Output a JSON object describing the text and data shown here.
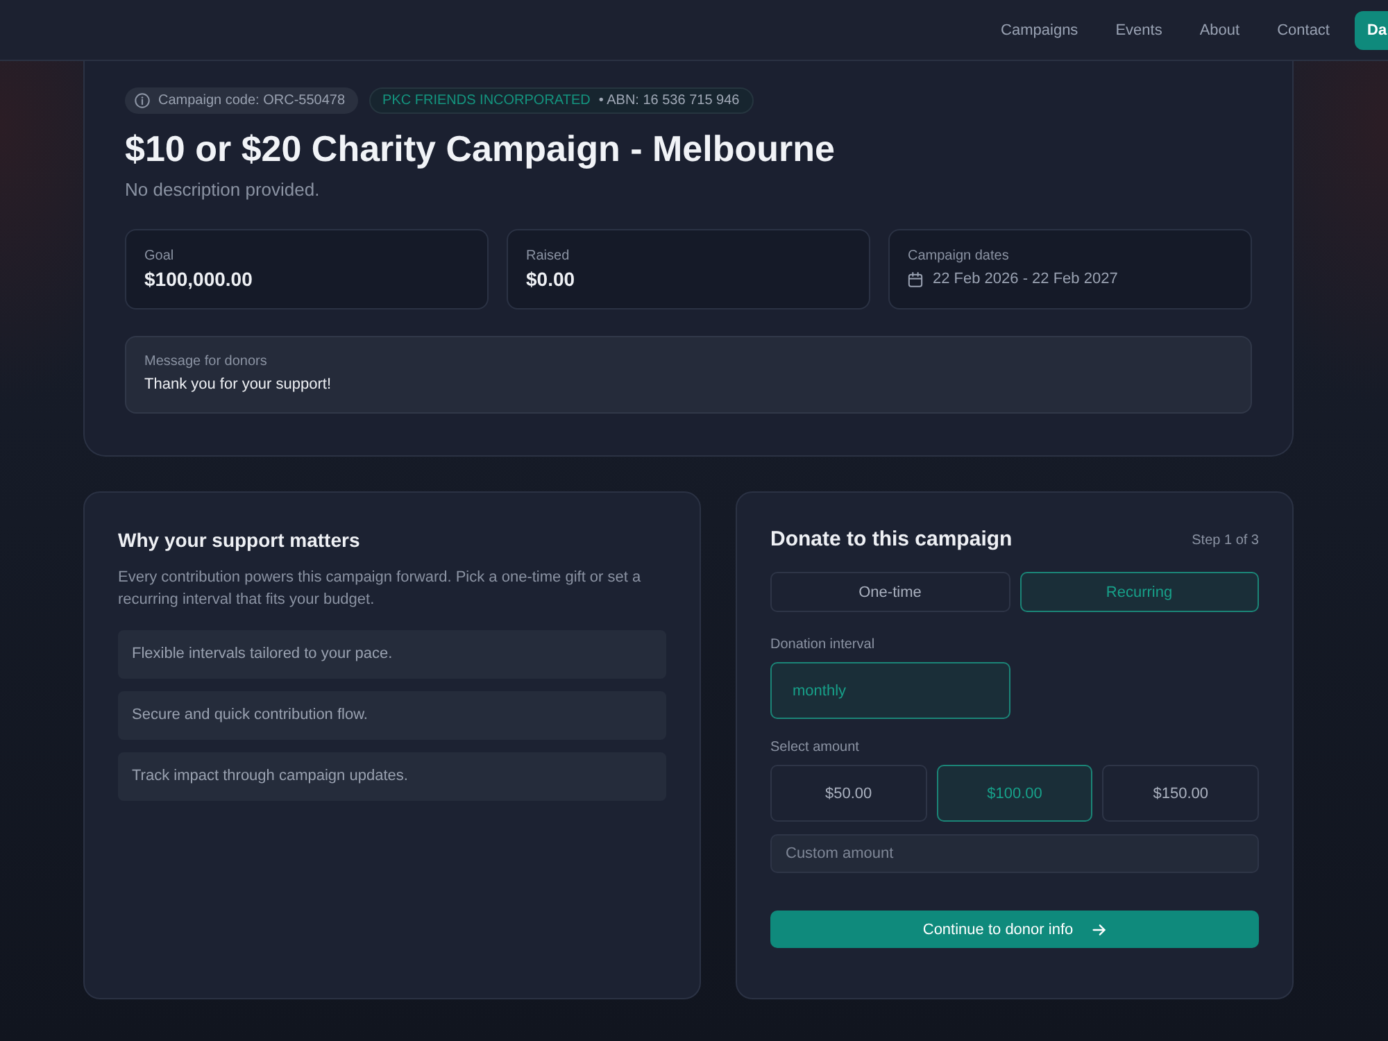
{
  "nav": {
    "links": [
      {
        "label": "Campaigns"
      },
      {
        "label": "Events"
      },
      {
        "label": "About"
      },
      {
        "label": "Contact"
      }
    ],
    "cta": "Da"
  },
  "campaign": {
    "code": "Campaign code: ORC-550478",
    "organization": "PKC FRIENDS INCORPORATED",
    "abn": "• ABN: 16 536 715 946",
    "title": "$10 or $20 Charity Campaign - Melbourne",
    "description": "No description provided.",
    "stats": [
      {
        "kind": "amount",
        "label": "Goal",
        "value": "$100,000.00"
      },
      {
        "kind": "amount",
        "label": "Raised",
        "value": "$0.00"
      },
      {
        "kind": "dates",
        "label": "Campaign dates",
        "value": "22 Feb 2026 - 22 Feb 2027"
      }
    ],
    "message": {
      "label": "Message for donors",
      "text": "Thank you for your support!"
    }
  },
  "support": {
    "title": "Why your support matters",
    "text": "Every contribution powers this campaign forward. Pick a one-time gift or set a recurring interval that fits your budget.",
    "points": [
      "Flexible intervals tailored to your pace.",
      "Secure and quick contribution flow.",
      "Track impact through campaign updates."
    ]
  },
  "donate": {
    "title": "Donate to this campaign",
    "step": "Step 1 of 3",
    "modes": [
      {
        "label": "One-time",
        "selected": false
      },
      {
        "label": "Recurring",
        "selected": true
      }
    ],
    "interval": {
      "label": "Donation interval",
      "options": [
        {
          "label": "monthly",
          "selected": true
        }
      ]
    },
    "amount": {
      "label": "Select amount",
      "options": [
        {
          "label": "$50.00",
          "selected": false
        },
        {
          "label": "$100.00",
          "selected": true
        },
        {
          "label": "$150.00",
          "selected": false
        }
      ],
      "custom": {
        "placeholder": "Custom amount"
      }
    },
    "continue": "Continue to donor info"
  }
}
